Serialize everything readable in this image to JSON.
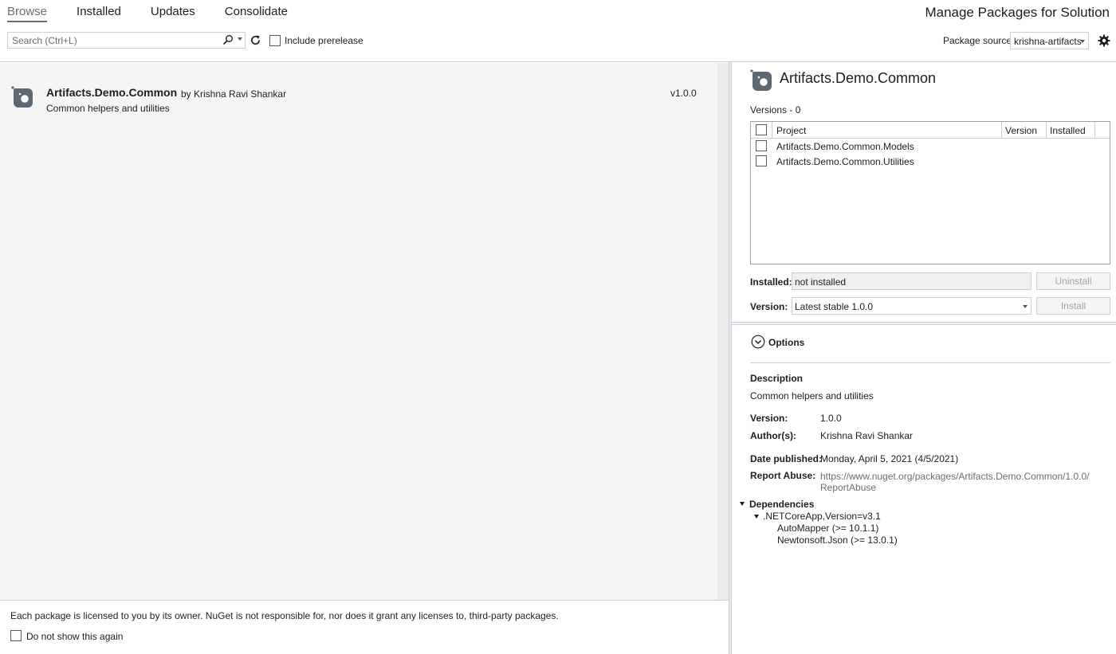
{
  "tabs": [
    {
      "label": "Browse",
      "active": true
    },
    {
      "label": "Installed",
      "active": false
    },
    {
      "label": "Updates",
      "active": false
    },
    {
      "label": "Consolidate",
      "active": false
    }
  ],
  "title": "Manage Packages for Solution",
  "search": {
    "placeholder": "Search (Ctrl+L)"
  },
  "prerelease": {
    "label": "Include prerelease",
    "checked": false
  },
  "package_source": {
    "label": "Package source:",
    "value": "krishna-artifacts"
  },
  "package_list": [
    {
      "name": "Artifacts.Demo.Common",
      "author": "by Krishna Ravi Shankar",
      "description": "Common helpers and utilities",
      "version": "v1.0.0"
    }
  ],
  "footer": {
    "license_text": "Each package is licensed to you by its owner. NuGet is not responsible for, nor does it grant any licenses to, third-party packages.",
    "do_not_show": "Do not show this again"
  },
  "details": {
    "title": "Artifacts.Demo.Common",
    "versions_label": "Versions - 0",
    "grid_headers": {
      "project": "Project",
      "version": "Version",
      "installed": "Installed"
    },
    "projects": [
      {
        "name": "Artifacts.Demo.Common.Models",
        "checked": false
      },
      {
        "name": "Artifacts.Demo.Common.Utilities",
        "checked": false
      }
    ],
    "installed_label": "Installed:",
    "installed_value": "not installed",
    "uninstall_button": "Uninstall",
    "version_label": "Version:",
    "version_value": "Latest stable 1.0.0",
    "install_button": "Install",
    "options_label": "Options",
    "description_heading": "Description",
    "description": "Common helpers and utilities",
    "version_key": "Version:",
    "version_val": "1.0.0",
    "authors_key": "Author(s):",
    "authors_val": "Krishna Ravi Shankar",
    "date_key": "Date published:",
    "date_val": "Monday, April 5, 2021 (4/5/2021)",
    "report_key": "Report Abuse:",
    "report_line1": "https://www.nuget.org/packages/Artifacts.Demo.Common/1.0.0/",
    "report_line2": "ReportAbuse",
    "dependencies_heading": "Dependencies",
    "framework": ".NETCoreApp,Version=v3.1",
    "dependencies": [
      "AutoMapper (>= 10.1.1)",
      "Newtonsoft.Json (>= 13.0.1)"
    ]
  },
  "colors": {
    "accent": "#6d6d6d",
    "border": "#cccedb",
    "list_bg": "#f5f5f5",
    "icon_dark": "#5c6873"
  }
}
